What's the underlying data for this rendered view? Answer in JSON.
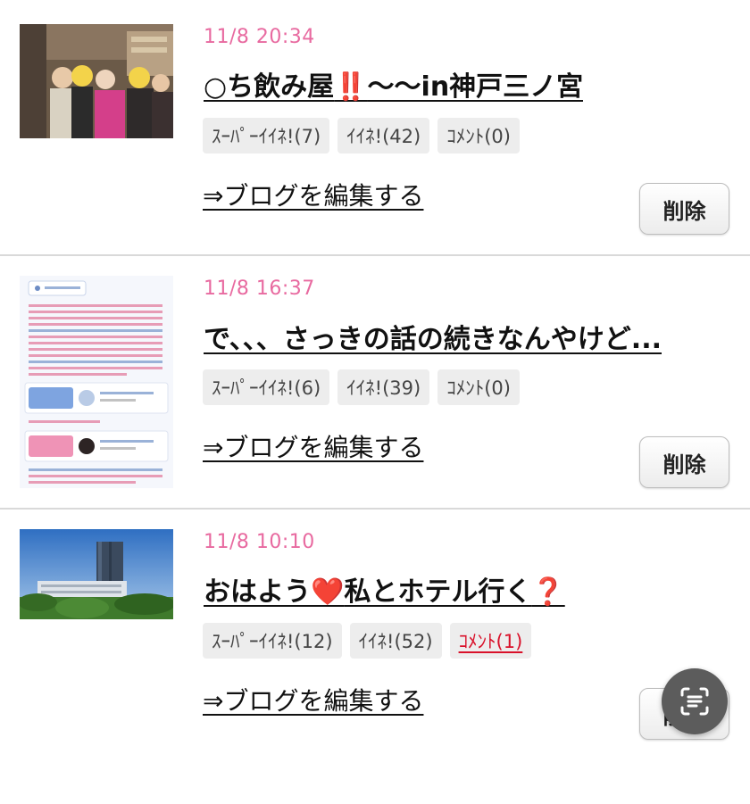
{
  "posts": [
    {
      "date": "11/8 20:34",
      "title_parts": [
        "○ち飲み屋",
        "‼️",
        "〜〜in神戸三ノ宮"
      ],
      "chips": [
        {
          "label": "ｽｰﾊﾟｰｲｲﾈ!(7)",
          "active": false
        },
        {
          "label": "ｲｲﾈ!(42)",
          "active": false
        },
        {
          "label": "ｺﾒﾝﾄ(0)",
          "active": false
        }
      ],
      "edit_label": "⇒ブログを編集する",
      "delete_label": "削除",
      "thumbnail": "bar-group-photo"
    },
    {
      "date": "11/8 16:37",
      "title_parts": [
        "で、、、さっきの話の続きなんやけど..."
      ],
      "chips": [
        {
          "label": "ｽｰﾊﾟｰｲｲﾈ!(6)",
          "active": false
        },
        {
          "label": "ｲｲﾈ!(39)",
          "active": false
        },
        {
          "label": "ｺﾒﾝﾄ(0)",
          "active": false
        }
      ],
      "edit_label": "⇒ブログを編集する",
      "delete_label": "削除",
      "thumbnail": "blog-screenshot"
    },
    {
      "date": "11/8 10:10",
      "title_parts": [
        "おはよう",
        "❤️",
        "私とホテル行く",
        "❓"
      ],
      "chips": [
        {
          "label": "ｽｰﾊﾟｰｲｲﾈ!(12)",
          "active": false
        },
        {
          "label": "ｲｲﾈ!(52)",
          "active": false
        },
        {
          "label": "ｺﾒﾝﾄ(1)",
          "active": true
        }
      ],
      "edit_label": "⇒ブログを編集する",
      "delete_label": "削除",
      "thumbnail": "hotel-building-photo"
    }
  ],
  "colors": {
    "date": "#e86aa0",
    "chip_bg": "#ededed",
    "chip_active": "#d9112a",
    "divider": "#d9d9d9",
    "fab": "#5c5c5c"
  },
  "icons": {
    "fab": "scan-text-icon"
  }
}
